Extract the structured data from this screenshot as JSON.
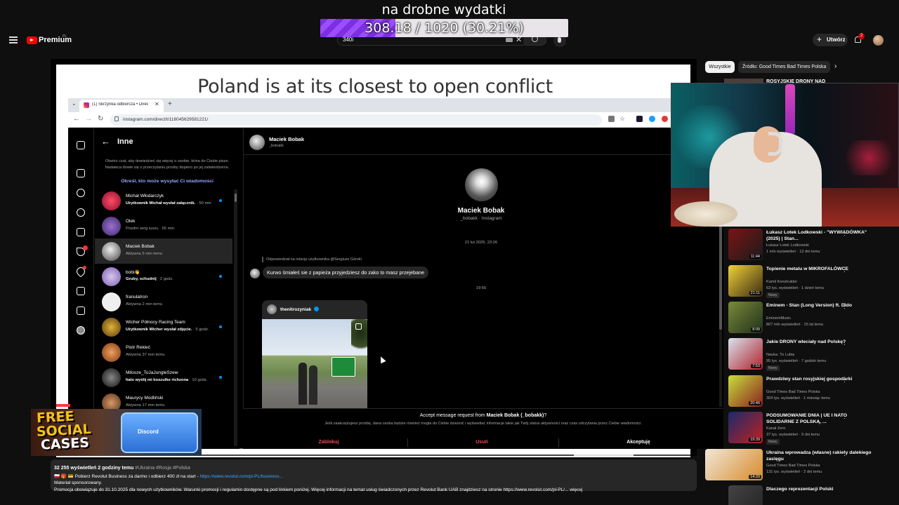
{
  "stream_goal": {
    "title": "na drobne wydatki",
    "progress_text": "308.18 / 1020 (30.21%)",
    "progress_fraction": 0.3021
  },
  "youtube": {
    "brand": "Premium",
    "brand_sup": "PL",
    "search_value": "340i",
    "create_label": "Utwórz",
    "notif_count": "2"
  },
  "video": {
    "slide_heading": "Poland is at its closest to open conflict"
  },
  "browser": {
    "tab_title": "(1) Skrzynka odbiorcza • Direct",
    "url": "instagram.com/direct/t/118045629581221/"
  },
  "instagram": {
    "list_title": "Inne",
    "info_text": "Otwórz czat, aby dowiedzieć się więcej o osobie, która do Ciebie pisze. Nadawca dowie się o przeczytaniu prośby dopiero po jej zatwierdzeniu.",
    "info_link": "Określ, kto może wysyłać Ci wiadomości",
    "conversations": [
      {
        "name": "Michał Włodarczyk",
        "sub_bold": "Użytkownik Michał wysłał załącznik.",
        "sub": " · 50 min",
        "unread": true
      },
      {
        "name": "Olek",
        "sub_bold": "",
        "sub": "Pozdro serg iuszu · 55 min",
        "unread": false
      },
      {
        "name": "Maciek Bobak",
        "sub_bold": "",
        "sub": "Aktywna 5 min temu",
        "unread": false
      },
      {
        "name": "bobi👋",
        "sub_bold": "Gruby, schudnij",
        "sub": " · 2 godz.",
        "unread": true
      },
      {
        "name": "franulatron",
        "sub_bold": "",
        "sub": "Aktywna 2 min temu",
        "unread": false
      },
      {
        "name": "Wicher Północy Racing Team",
        "sub_bold": "Użytkownik Wicher wysłał zdjęcie.",
        "sub": " · 5 godz.",
        "unread": true
      },
      {
        "name": "Piotr Rekieć",
        "sub_bold": "",
        "sub": "Aktywna 37 min temu",
        "unread": false
      },
      {
        "name": "Milosze_ToJaJungleSzew",
        "sub_bold": "halo wyślij mi koszulke richzona",
        "sub": " · 10 godz.",
        "unread": true
      },
      {
        "name": "Maurycy Modliński",
        "sub_bold": "",
        "sub": "Aktywna 17 min temu",
        "unread": false
      }
    ],
    "chat": {
      "name": "Maciek Bobak",
      "username": "_bobakk",
      "profile_sub": "_bobakk · Instagram",
      "timestamp1": "21 lut 2025, 23:26",
      "reply_note": "Odpowiedział na relację użytkownika @Sergiusz Górski",
      "message1": "Kurwo śmiałeś sie z papieża przyjedziesz do zako to masz przejebane",
      "timestamp2": "19:56",
      "post_user": "thenitrozyniak"
    },
    "request": {
      "title_prefix": "Accept message request from ",
      "title_name": "Maciek Bobak (_bobakk)",
      "title_suffix": "?",
      "info": "Jeśli zaakceptujesz prośbę, dana osoba będzie również mogła do Ciebie dzwonić i wyświetlać informacje takie jak Twój status aktywności oraz czas odczytania przez Ciebie wiadomości.",
      "block": "Zablokuj",
      "delete": "Usuń",
      "accept": "Akceptuję"
    }
  },
  "description": {
    "views": "32 255 wyświetleń",
    "age": "2 godziny temu",
    "tags": "#Ukraina #Rosja #Polska",
    "line2": "🇵🇱 🎁 💳 Pobierz Revolut Business za darmo i odbierz 400 zł na start - ",
    "line2_link": "https://www.revolut.com/pl-PL/business...",
    "line3": "Materiał sponsorowany.",
    "line4": "Promocja obowiązuje do 31.10.2025 dla nowych użytkowników. Warunki promocji i regulamin dostępne są pod linkiem poniżej. Więcej informacji na temat usług świadczonych przez Revolut Bank UAB znajdziesz na stronie https://www.revolut.com/pl-PL/... więcej"
  },
  "sidebar": {
    "chip_all": "Wszystkie",
    "chip_source": "Źródło: Good Times Bad Times Polska",
    "top_title": "ROSYJSKIE DRONY NAD",
    "recommendations": [
      {
        "title": "Łukasz Lotek Lodkowski - \"WYWIADÓWKA\" (2025) | Stan...",
        "channel": "Łukasz Lotek Lodkowski",
        "meta": "1 mln wyświetleń · 12 dni temu",
        "duration": "11:44",
        "new": false
      },
      {
        "title": "Topienie metalu w MIKROFALÓWCE",
        "channel": "Kamil Konstruktor",
        "meta": "63 tys. wyświetleń · 1 dzień temu",
        "duration": "21:11",
        "new": true
      },
      {
        "title": "Eminem - Stan (Long Version) ft. Dido",
        "channel": "EminemMusic",
        "meta": "807 mln wyświetleń · 15 lat temu",
        "duration": "8:09",
        "new": false
      },
      {
        "title": "Jakie DRONY wleciały nad Polskę?",
        "channel": "Nauka. To Lubię",
        "meta": "95 tys. wyświetleń · 7 godzin temu",
        "duration": "7:53",
        "new": true
      },
      {
        "title": "Prawdziwy stan rosyjskiej gospodarki",
        "channel": "Good Times Bad Times Polska",
        "meta": "304 tys. wyświetleń · 1 miesiąc temu",
        "duration": "20:46",
        "new": false
      },
      {
        "title": "PODSUMOWANIE DNIA | UE I NATO SOLIDARNE Z POLSKĄ, ...",
        "channel": "Kanał Zero",
        "meta": "37 tys. wyświetleń · 9 dni temu",
        "duration": "19:39",
        "new": true
      },
      {
        "title": "Ukraina wprowadza (własne) rakiety dalekiego zasięgu",
        "channel": "Good Times Bad Times Polska",
        "meta": "131 tys. wyświetleń · 2 dni temu",
        "duration": "14:20",
        "new": false
      },
      {
        "title": "Dlaczego reprezentacji Polski",
        "channel": "",
        "meta": "",
        "duration": "",
        "new": false
      }
    ]
  },
  "promo": {
    "line1": "FREE",
    "line2": "SOCIAL",
    "line3": "CASES",
    "case_label": "Discord"
  }
}
